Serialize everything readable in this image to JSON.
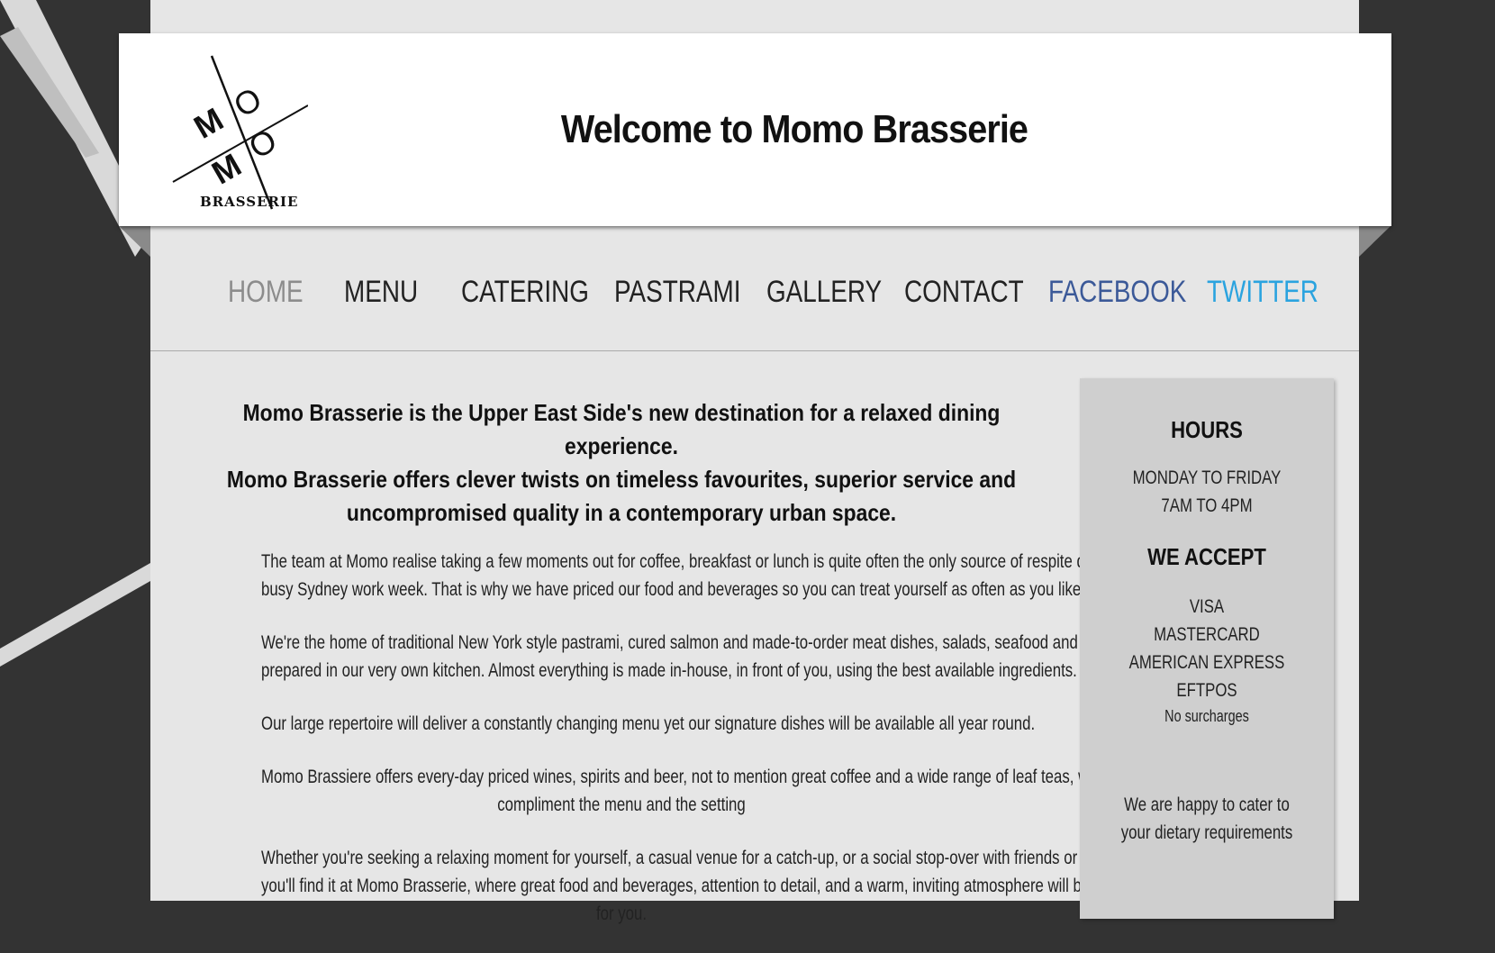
{
  "header": {
    "title": "Welcome to Momo Brasserie",
    "logo_text": "BRASSERIE",
    "logo_letters": [
      "M",
      "O",
      "M",
      "O"
    ]
  },
  "nav": {
    "items": [
      {
        "label": "HOME",
        "color": "#8c8c8c"
      },
      {
        "label": "MENU",
        "color": "#222222"
      },
      {
        "label": "CATERING",
        "color": "#222222"
      },
      {
        "label": "PASTRAMI",
        "color": "#222222"
      },
      {
        "label": "GALLERY",
        "color": "#222222"
      },
      {
        "label": "CONTACT",
        "color": "#222222"
      },
      {
        "label": "FACEBOOK",
        "color": "#3b5998"
      },
      {
        "label": "TWITTER",
        "color": "#2aa3df"
      }
    ]
  },
  "main": {
    "lead": [
      "Momo Brasserie is the Upper East Side's new destination for a relaxed dining experience.",
      "Momo Brasserie offers clever twists on timeless favourites, superior service and",
      "uncompromised quality in a contemporary urban space."
    ],
    "paragraphs": [
      [
        "The team at Momo realise taking a few moments out for coffee, breakfast or lunch is quite often the only source of respite during a",
        "busy Sydney work week. That is why we have priced our food and beverages so you can treat yourself as often as you like."
      ],
      [
        "We're the home of traditional New York style pastrami, cured salmon and made-to-order meat dishes, salads, seafood and sandwiches",
        "prepared in our very own kitchen. Almost everything is made in-house, in front of you, using the best available ingredients."
      ],
      [
        "Our large repertoire will deliver a constantly changing menu yet our signature dishes will be available all year round."
      ],
      [
        "Momo Brassiere offers every-day priced wines, spirits and beer, not to mention great coffee and a wide range of leaf teas, which",
        "compliment the menu and the setting"
      ],
      [
        "Whether you're seeking a relaxing moment for yourself, a casual venue for a catch-up, or a social stop-over with friends or colleagues,",
        "you'll find it at Momo Brasserie, where great food and beverages, attention to detail, and a warm, inviting atmosphere will be waiting",
        "for you."
      ]
    ]
  },
  "sidebar": {
    "hours_heading": "HOURS",
    "hours_lines": [
      "MONDAY TO FRIDAY",
      "7AM TO 4PM"
    ],
    "accept_heading": "WE ACCEPT",
    "accept_lines": [
      "VISA",
      "MASTERCARD",
      "AMERICAN EXPRESS",
      "EFTPOS"
    ],
    "surcharge_note": "No surcharges",
    "dietary_lines": [
      "We are happy to cater to",
      "your dietary requirements"
    ]
  }
}
